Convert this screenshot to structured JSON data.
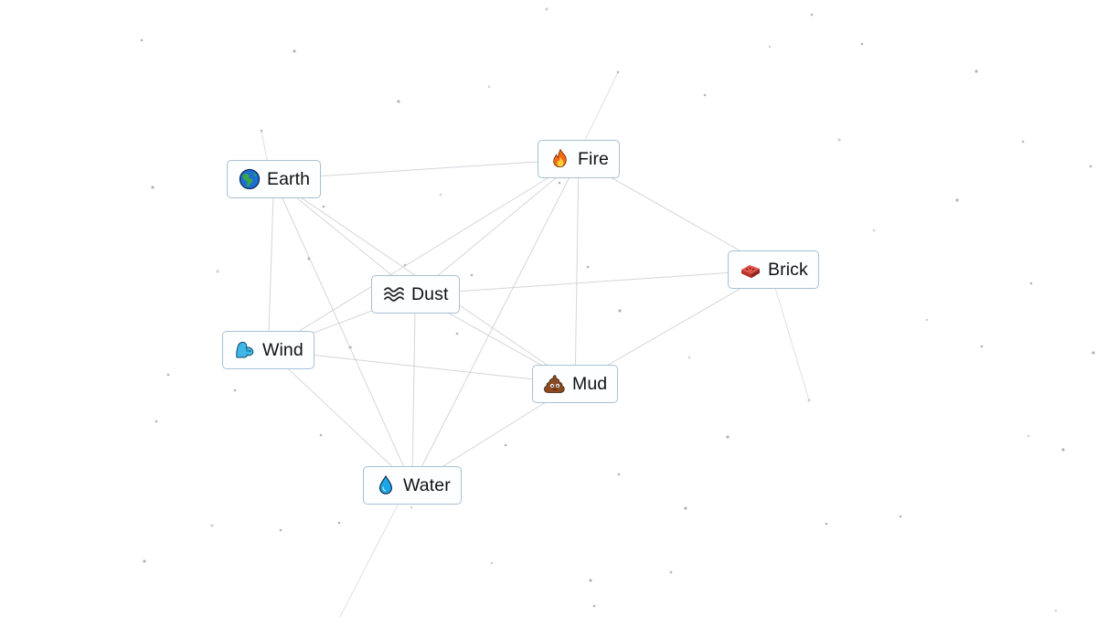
{
  "elements": [
    {
      "id": "earth",
      "label": "Earth",
      "icon": "earth-globe-icon"
    },
    {
      "id": "fire",
      "label": "Fire",
      "icon": "fire-icon"
    },
    {
      "id": "dust",
      "label": "Dust",
      "icon": "dust-waves-icon"
    },
    {
      "id": "brick",
      "label": "Brick",
      "icon": "brick-icon"
    },
    {
      "id": "wind",
      "label": "Wind",
      "icon": "wind-face-icon"
    },
    {
      "id": "mud",
      "label": "Mud",
      "icon": "mud-pile-icon"
    },
    {
      "id": "water",
      "label": "Water",
      "icon": "water-droplet-icon"
    }
  ],
  "connections": [
    [
      "earth",
      "fire"
    ],
    [
      "earth",
      "dust"
    ],
    [
      "earth",
      "wind"
    ],
    [
      "earth",
      "water"
    ],
    [
      "earth",
      "mud"
    ],
    [
      "fire",
      "dust"
    ],
    [
      "fire",
      "brick"
    ],
    [
      "fire",
      "mud"
    ],
    [
      "fire",
      "water"
    ],
    [
      "fire",
      "wind"
    ],
    [
      "dust",
      "brick"
    ],
    [
      "dust",
      "mud"
    ],
    [
      "dust",
      "water"
    ],
    [
      "dust",
      "wind"
    ],
    [
      "wind",
      "mud"
    ],
    [
      "wind",
      "water"
    ],
    [
      "mud",
      "water"
    ],
    [
      "mud",
      "brick"
    ]
  ],
  "colors": {
    "background": "#ffffff",
    "tile_border": "#a9c0d6",
    "tile_fill": "#fcfeff",
    "line": "#c9ccd2",
    "dot": "#9a9a9a"
  }
}
